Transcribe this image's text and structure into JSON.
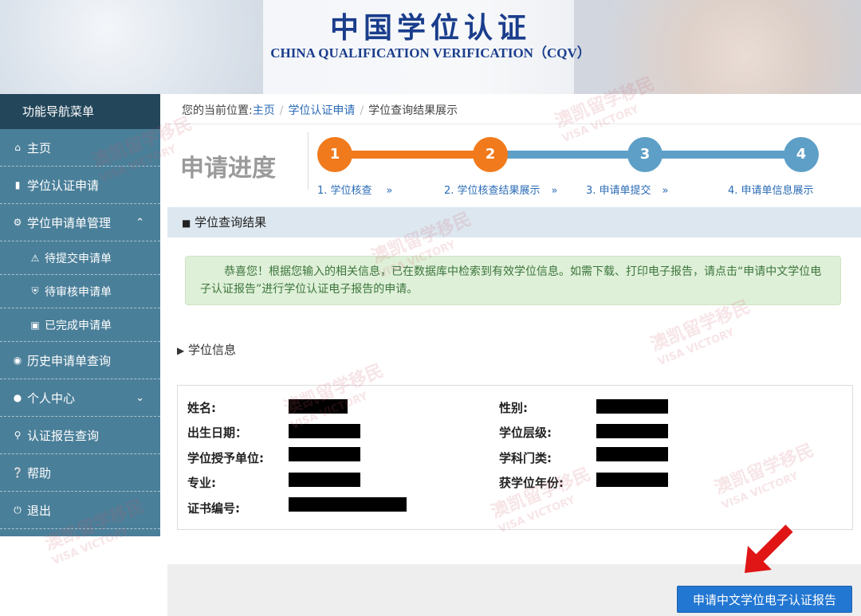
{
  "header": {
    "title_cn": "中国学位认证",
    "title_en": "CHINA QUALIFICATION VERIFICATION（CQV）"
  },
  "sidebar": {
    "title": "功能导航菜单",
    "items": [
      {
        "label": "主页",
        "icon": "home-icon"
      },
      {
        "label": "学位认证申请",
        "icon": "document-icon"
      },
      {
        "label": "学位申请单管理",
        "icon": "gear-icon",
        "chevron": "up"
      },
      {
        "label": "待提交申请单",
        "icon": "warning-icon",
        "sub": true
      },
      {
        "label": "待审核申请单",
        "icon": "cart-icon",
        "sub": true
      },
      {
        "label": "已完成申请单",
        "icon": "briefcase-icon",
        "sub": true
      },
      {
        "label": "历史申请单查询",
        "icon": "camera-icon"
      },
      {
        "label": "个人中心",
        "icon": "user-icon",
        "chevron": "down"
      },
      {
        "label": "认证报告查询",
        "icon": "search-icon"
      },
      {
        "label": "帮助",
        "icon": "help-icon"
      },
      {
        "label": "退出",
        "icon": "power-icon"
      }
    ]
  },
  "breadcrumb": {
    "prefix": "您的当前位置:",
    "items": [
      "主页",
      "学位认证申请",
      "学位查询结果展示"
    ]
  },
  "progress": {
    "heading": "申请进度",
    "steps": [
      {
        "num": "1",
        "label": "1. 学位核查"
      },
      {
        "num": "2",
        "label": "2. 学位核查结果展示"
      },
      {
        "num": "3",
        "label": "3. 申请单提交"
      },
      {
        "num": "4",
        "label": "4. 申请单信息展示"
      }
    ],
    "arrow": "»",
    "colors": {
      "done": "#f07a1c",
      "todo": "#5d9fc7"
    }
  },
  "result": {
    "heading": "学位查询结果",
    "message": "恭喜您！根据您输入的相关信息，已在数据库中检索到有效学位信息。如需下载、打印电子报告，请点击“申请中文学位电子认证报告”进行学位认证电子报告的申请。"
  },
  "degree_info": {
    "heading": "学位信息",
    "fields_left": [
      "姓名:",
      "出生日期：",
      "学位授予单位:",
      "专业:",
      "证书编号:"
    ],
    "fields_right": [
      "性别:",
      "学位层级:",
      "学科门类:",
      "获学位年份:"
    ]
  },
  "actions": {
    "apply_label": "申请中文学位电子认证报告"
  },
  "watermark": {
    "cn": "澳凯留学移民",
    "en": "VISA VICTORY"
  }
}
